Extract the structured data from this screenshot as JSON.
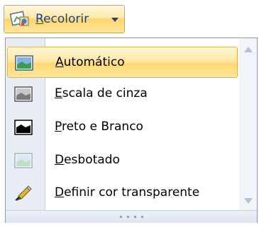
{
  "ribbon": {
    "button": {
      "label_first": "R",
      "label_rest": "ecolorir",
      "icon": "recolor-icon",
      "dropdown_icon": "chevron-down-icon"
    }
  },
  "menu": {
    "items": [
      {
        "mnemonic": "A",
        "rest": "utomático",
        "icon": "automatic-picture-icon",
        "selected": true
      },
      {
        "mnemonic": "E",
        "rest": "scala de cinza",
        "icon": "grayscale-picture-icon",
        "selected": false
      },
      {
        "mnemonic": "P",
        "rest": "reto e Branco",
        "icon": "black-white-picture-icon",
        "selected": false
      },
      {
        "mnemonic": "D",
        "rest": "esbotado",
        "icon": "washout-picture-icon",
        "selected": false
      },
      {
        "mnemonic": "D",
        "rest": "efinir cor transparente",
        "icon": "pencil-eyedropper-icon",
        "selected": false
      }
    ],
    "scrollbar": {
      "up_icon": "scroll-up-arrow-icon",
      "down_icon": "scroll-down-arrow-icon"
    },
    "grip_icon": "resize-grip-icon"
  },
  "colors": {
    "ribbon_text": "#15428b",
    "highlight_border": "#e3b35a",
    "menu_border": "#8a9ab6"
  }
}
